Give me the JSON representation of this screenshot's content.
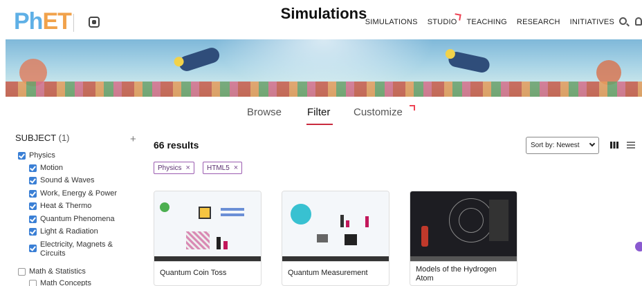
{
  "header": {
    "logo_ph": "Ph",
    "logo_et": "ET",
    "nav": [
      "SIMULATIONS",
      "STUDIO",
      "TEACHING",
      "RESEARCH",
      "INITIATIVES"
    ]
  },
  "banner": {
    "title": "Simulations"
  },
  "tabs": [
    {
      "label": "Browse"
    },
    {
      "label": "Filter",
      "active": true
    },
    {
      "label": "Customize"
    }
  ],
  "sidebar": {
    "subject_label": "SUBJECT",
    "subject_count": "(1)",
    "items": [
      {
        "label": "Physics",
        "checked": true
      },
      {
        "label": "Motion",
        "checked": true
      },
      {
        "label": "Sound & Waves",
        "checked": true
      },
      {
        "label": "Work, Energy & Power",
        "checked": true
      },
      {
        "label": "Heat & Thermo",
        "checked": true
      },
      {
        "label": "Quantum Phenomena",
        "checked": true
      },
      {
        "label": "Light & Radiation",
        "checked": true
      },
      {
        "label": "Electricity, Magnets & Circuits",
        "checked": true
      },
      {
        "label": "Math & Statistics",
        "checked": false
      },
      {
        "label": "Math Concepts",
        "checked": false
      }
    ]
  },
  "results": {
    "count": "66 results",
    "chips": [
      "Physics",
      "HTML5"
    ],
    "chip_close": "×",
    "sort_label": "Sort by: Newest"
  },
  "cards": [
    {
      "title": "Quantum Coin Toss"
    },
    {
      "title": "Quantum Measurement"
    },
    {
      "title": "Models of the Hydrogen Atom"
    }
  ],
  "colors": {
    "accent": "#c92b3e",
    "checkbox": "#3a7fd5",
    "chip": "#9a5bb0"
  }
}
